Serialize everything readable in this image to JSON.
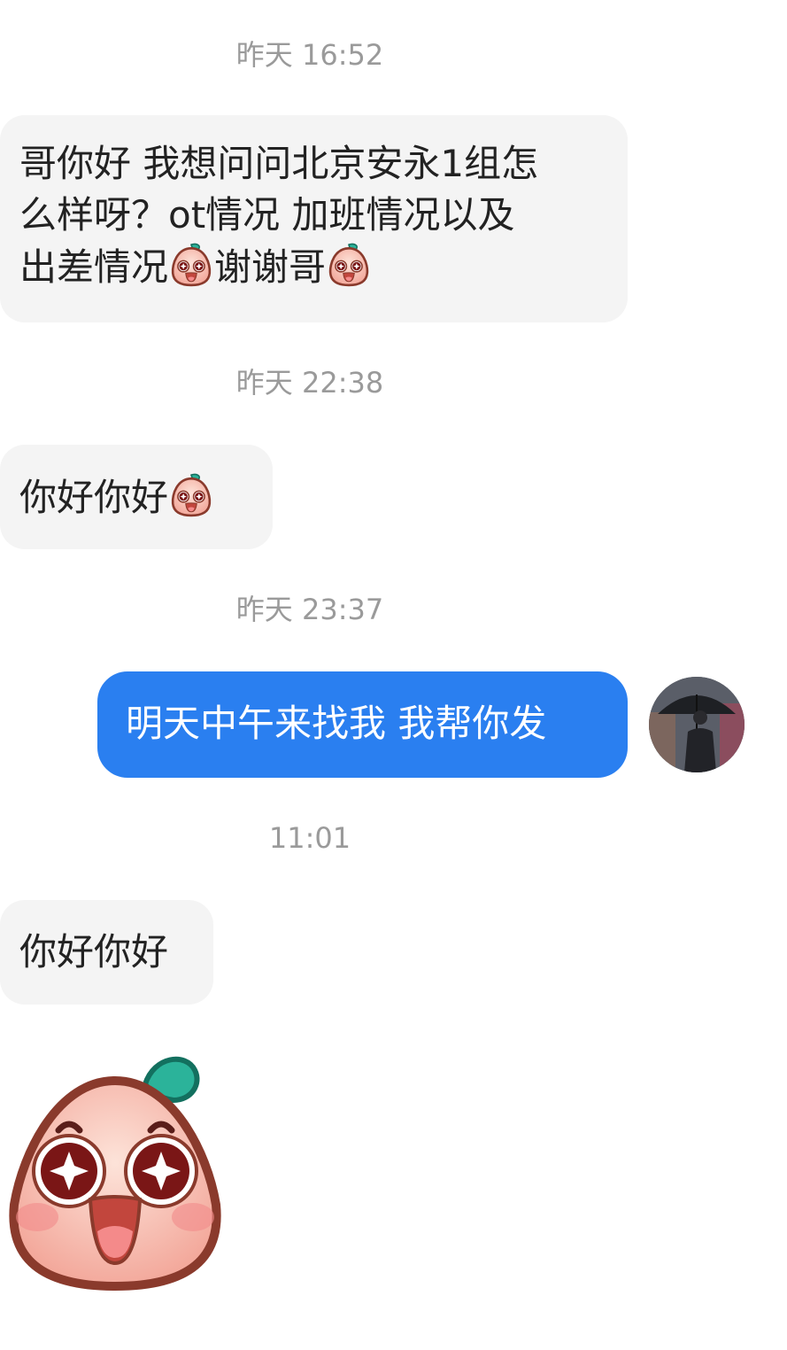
{
  "conversation": {
    "messages": [
      {
        "timestamp": "昨天 16:52",
        "sender": "other",
        "text_line1": "哥你好 我想问问北京安永1组怎",
        "text_line2": "么样呀？ot情况 加班情况以及",
        "text_line3a": "出差情况",
        "text_line3b": "谢谢哥",
        "emojis": [
          "peach-face-emoji",
          "peach-face-emoji"
        ]
      },
      {
        "timestamp": "昨天 22:38",
        "sender": "other",
        "text": "你好你好",
        "emojis": [
          "peach-face-emoji"
        ]
      },
      {
        "timestamp": "昨天 23:37",
        "sender": "me",
        "text": "明天中午来找我 我帮你发"
      },
      {
        "timestamp": "11:01",
        "sender": "other",
        "text": "你好你好"
      },
      {
        "sender": "other",
        "sticker": "peach-face-sticker"
      }
    ]
  },
  "colors": {
    "outgoing_bubble": "#2a7ff0",
    "incoming_bubble": "#f4f4f4",
    "timestamp_text": "#9a9a9a"
  }
}
